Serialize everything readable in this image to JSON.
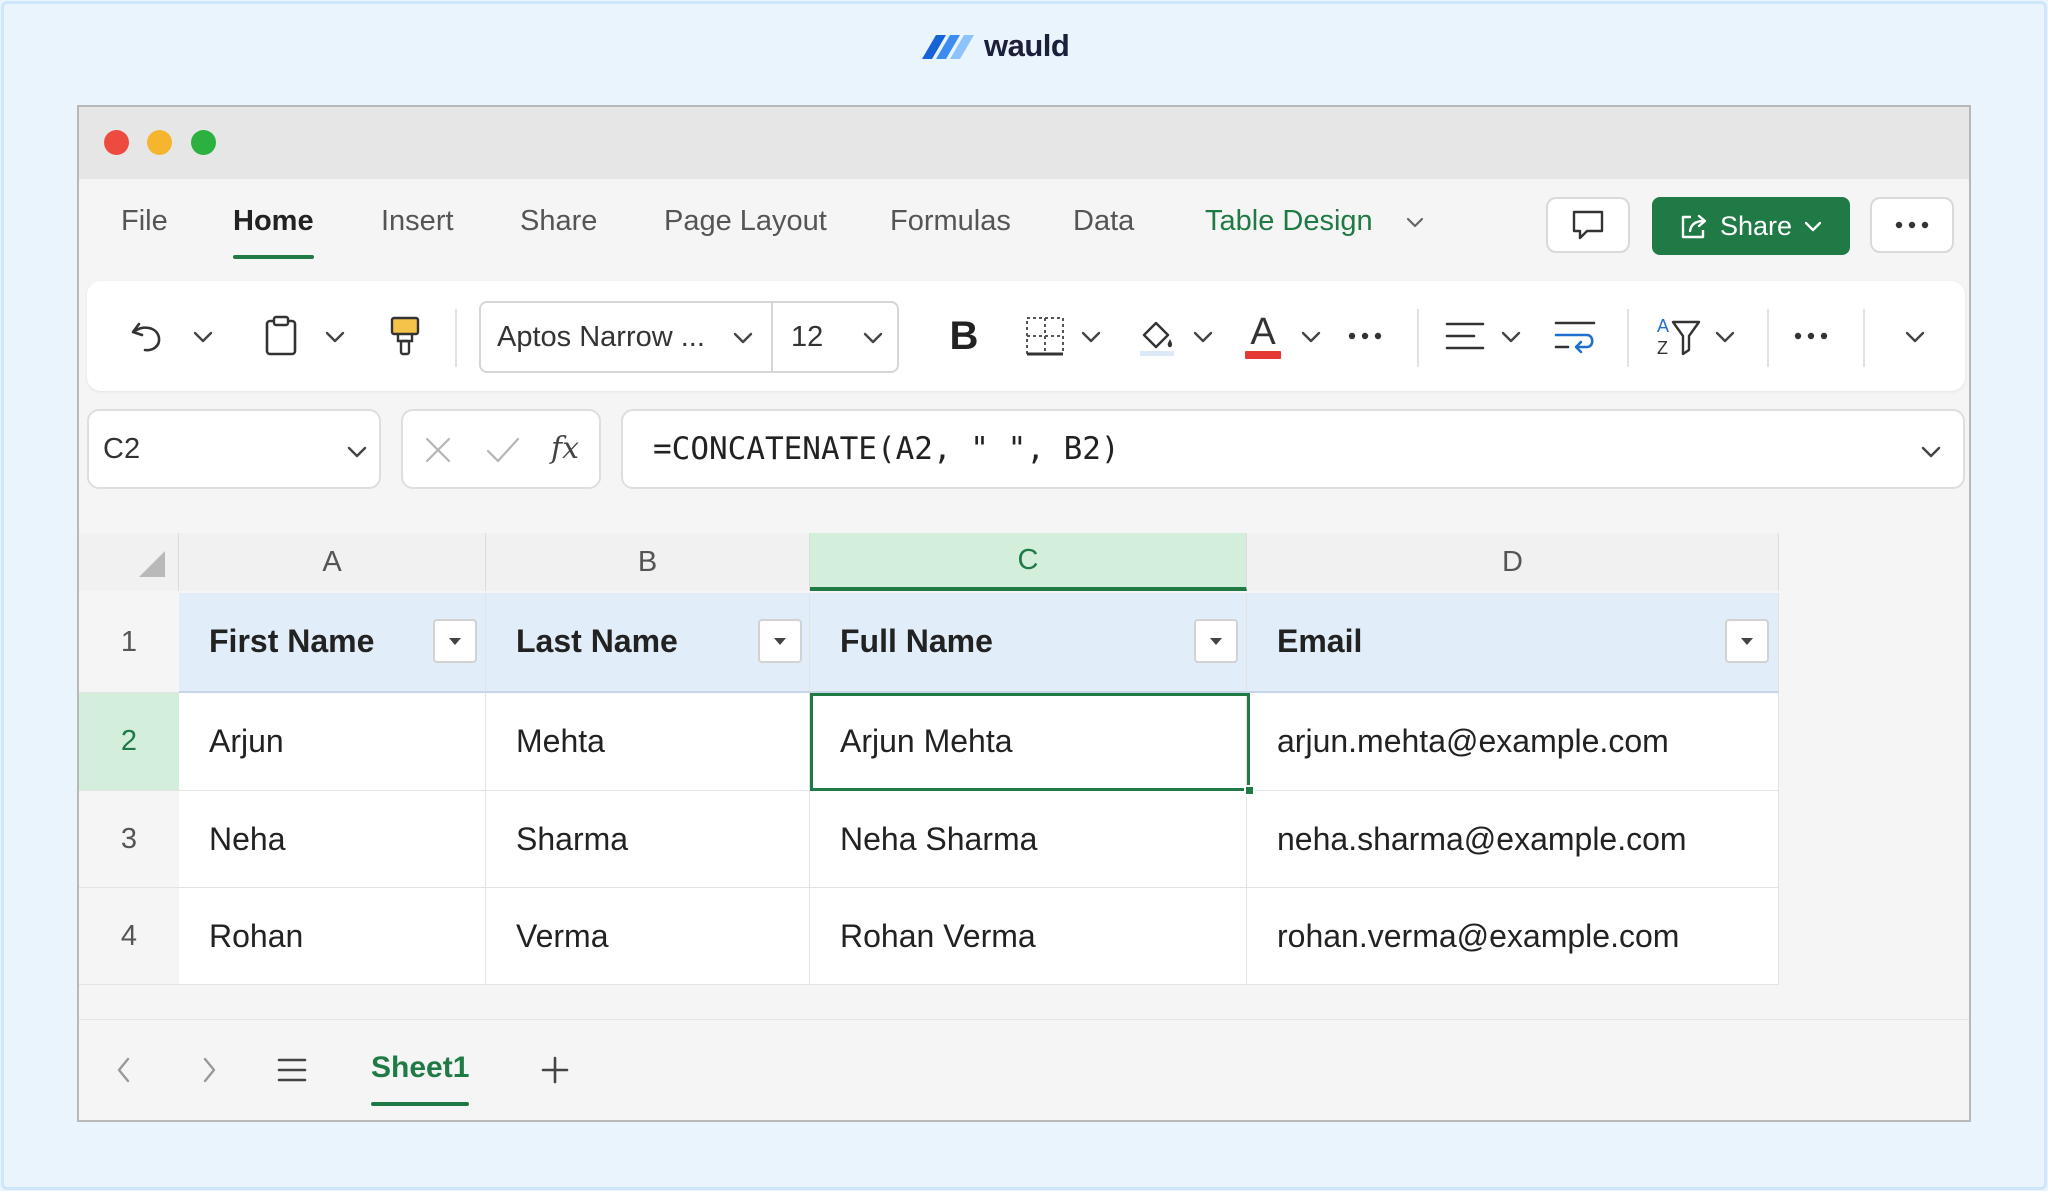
{
  "brand": {
    "name": "wauld"
  },
  "tabs": [
    {
      "label": "File"
    },
    {
      "label": "Home"
    },
    {
      "label": "Insert"
    },
    {
      "label": "Share"
    },
    {
      "label": "Page Layout"
    },
    {
      "label": "Formulas"
    },
    {
      "label": "Data"
    },
    {
      "label": "Table Design"
    }
  ],
  "active_tab": "Home",
  "share_button": {
    "label": "Share"
  },
  "ribbon": {
    "font_name": "Aptos Narrow ...",
    "font_size": "12",
    "bold_label": "B",
    "font_color_label": "A"
  },
  "formula_bar": {
    "name_box": "C2",
    "fx_label": "fx",
    "formula": "=CONCATENATE(A2, \" \", B2)"
  },
  "grid": {
    "columns": [
      "A",
      "B",
      "C",
      "D"
    ],
    "selected_column": "C",
    "row_numbers": [
      "1",
      "2",
      "3",
      "4"
    ],
    "selected_row": "2",
    "header_row": [
      "First Name",
      "Last Name",
      "Full Name",
      "Email"
    ],
    "rows": [
      [
        "Arjun",
        "Mehta",
        "Arjun Mehta",
        "arjun.mehta@example.com"
      ],
      [
        "Neha",
        "Sharma",
        "Neha Sharma",
        "neha.sharma@example.com"
      ],
      [
        "Rohan",
        "Verma",
        "Rohan Verma",
        "rohan.verma@example.com"
      ]
    ],
    "selected_cell": "C2"
  },
  "sheets": [
    {
      "label": "Sheet1"
    }
  ],
  "colors": {
    "accent_green": "#1f7a45",
    "table_header_bg": "#e1edf8",
    "selection_bg": "#d3efdc",
    "font_color_swatch": "#e53935"
  }
}
